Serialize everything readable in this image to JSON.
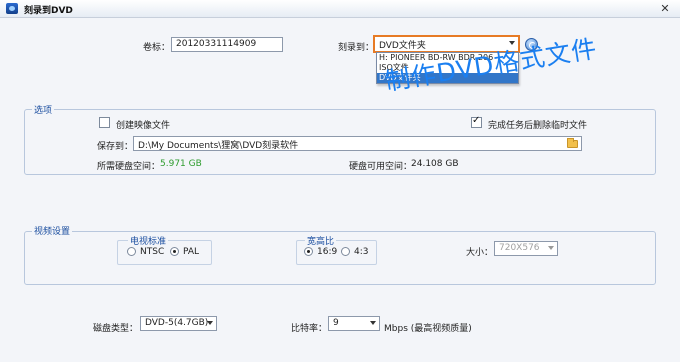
{
  "window": {
    "title": "刻录到DVD",
    "close_glyph": "✕"
  },
  "top": {
    "volume_label": "卷标：",
    "volume_value": "20120331114909",
    "burn_to_label": "刻录到：",
    "burn_to_value": "DVD文件夹",
    "burn_options": [
      "H: PIONEER  BD-RW   BDR-206",
      "ISO文件",
      "DVD文件夹"
    ]
  },
  "overlay": {
    "caption": "制作DVD格式文件",
    "color": "#1b7ff0"
  },
  "options": {
    "title": "选项",
    "create_image_label": "创建映像文件",
    "create_image_checked": false,
    "delete_temp_label": "完成任务后删除临时文件",
    "delete_temp_checked": true,
    "save_to_label": "保存到：",
    "save_to_path": "D:\\My Documents\\狸窝\\DVD刻录软件",
    "required_space_label": "所需硬盘空间：",
    "required_space_value": "5.971 GB",
    "available_space_label": "硬盘可用空间：",
    "available_space_value": "24.108 GB"
  },
  "video": {
    "title": "视频设置",
    "tv_standard_title": "电视标准",
    "ntsc_label": "NTSC",
    "pal_label": "PAL",
    "selected_standard": "PAL",
    "aspect_title": "宽高比",
    "aspect_169": "16:9",
    "aspect_43": "4:3",
    "selected_aspect": "16:9",
    "size_label": "大小：",
    "size_value": "720X576"
  },
  "bottom": {
    "disc_type_label": "磁盘类型：",
    "disc_type_value": "DVD-5(4.7GB)",
    "bitrate_label": "比特率：",
    "bitrate_value": "9",
    "bitrate_unit": "Mbps (最高视频质量)"
  }
}
